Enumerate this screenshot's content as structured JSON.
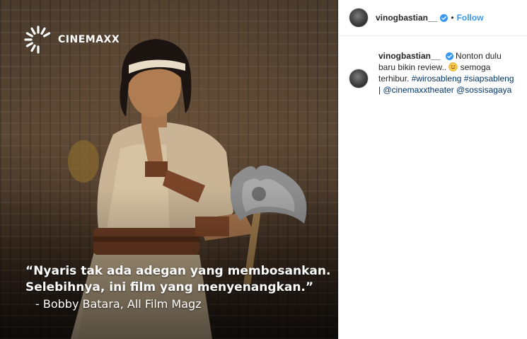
{
  "media": {
    "brand": "CINEMAXX",
    "quote_line_1": "“Nyaris tak ada adegan yang membosankan.",
    "quote_line_2": "Selebihnya, ini film yang menyenangkan.”",
    "quote_credit": "- Bobby Batara, All Film Magz"
  },
  "header": {
    "username": "vinogbastian__",
    "separator": "•",
    "follow_label": "Follow",
    "verified_icon": "verified-badge-icon"
  },
  "caption": {
    "username": "vinogbastian__",
    "text_1": "Nonton dulu baru bikin review..",
    "emoji_icon": "smiling-face-emoji",
    "text_2": "semoga terhibur.",
    "hashtag_1": "#wirosableng",
    "hashtag_2": "#siapsableng",
    "divider": "|",
    "mention_1": "@cinemaxxtheater",
    "mention_2": "@sossisagaya"
  },
  "colors": {
    "link": "#003569",
    "follow": "#3897f0",
    "verified": "#3897f0"
  }
}
